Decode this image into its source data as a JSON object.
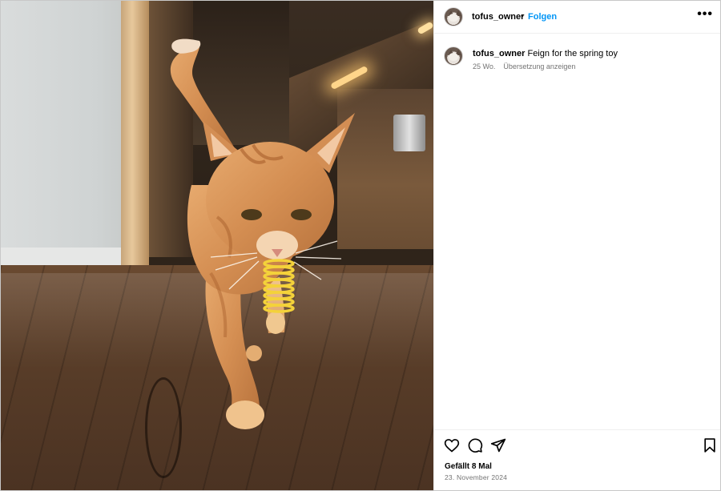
{
  "post": {
    "username": "tofus_owner",
    "separator": "•",
    "follow_label": "Folgen",
    "more_label": "•••",
    "caption_user": "tofus_owner",
    "caption_text": "Feign for the spring toy",
    "age": "25 Wo.",
    "translate_label": "Übersetzung anzeigen",
    "likes": "Gefällt 8 Mal",
    "date": "23. November 2024"
  },
  "icons": {
    "like": "heart-icon",
    "comment": "comment-icon",
    "share": "send-icon",
    "save": "bookmark-icon",
    "more": "more-dots-icon"
  },
  "colors": {
    "accent": "#0095f6",
    "secondary_text": "#737373",
    "divider": "#efefef"
  }
}
